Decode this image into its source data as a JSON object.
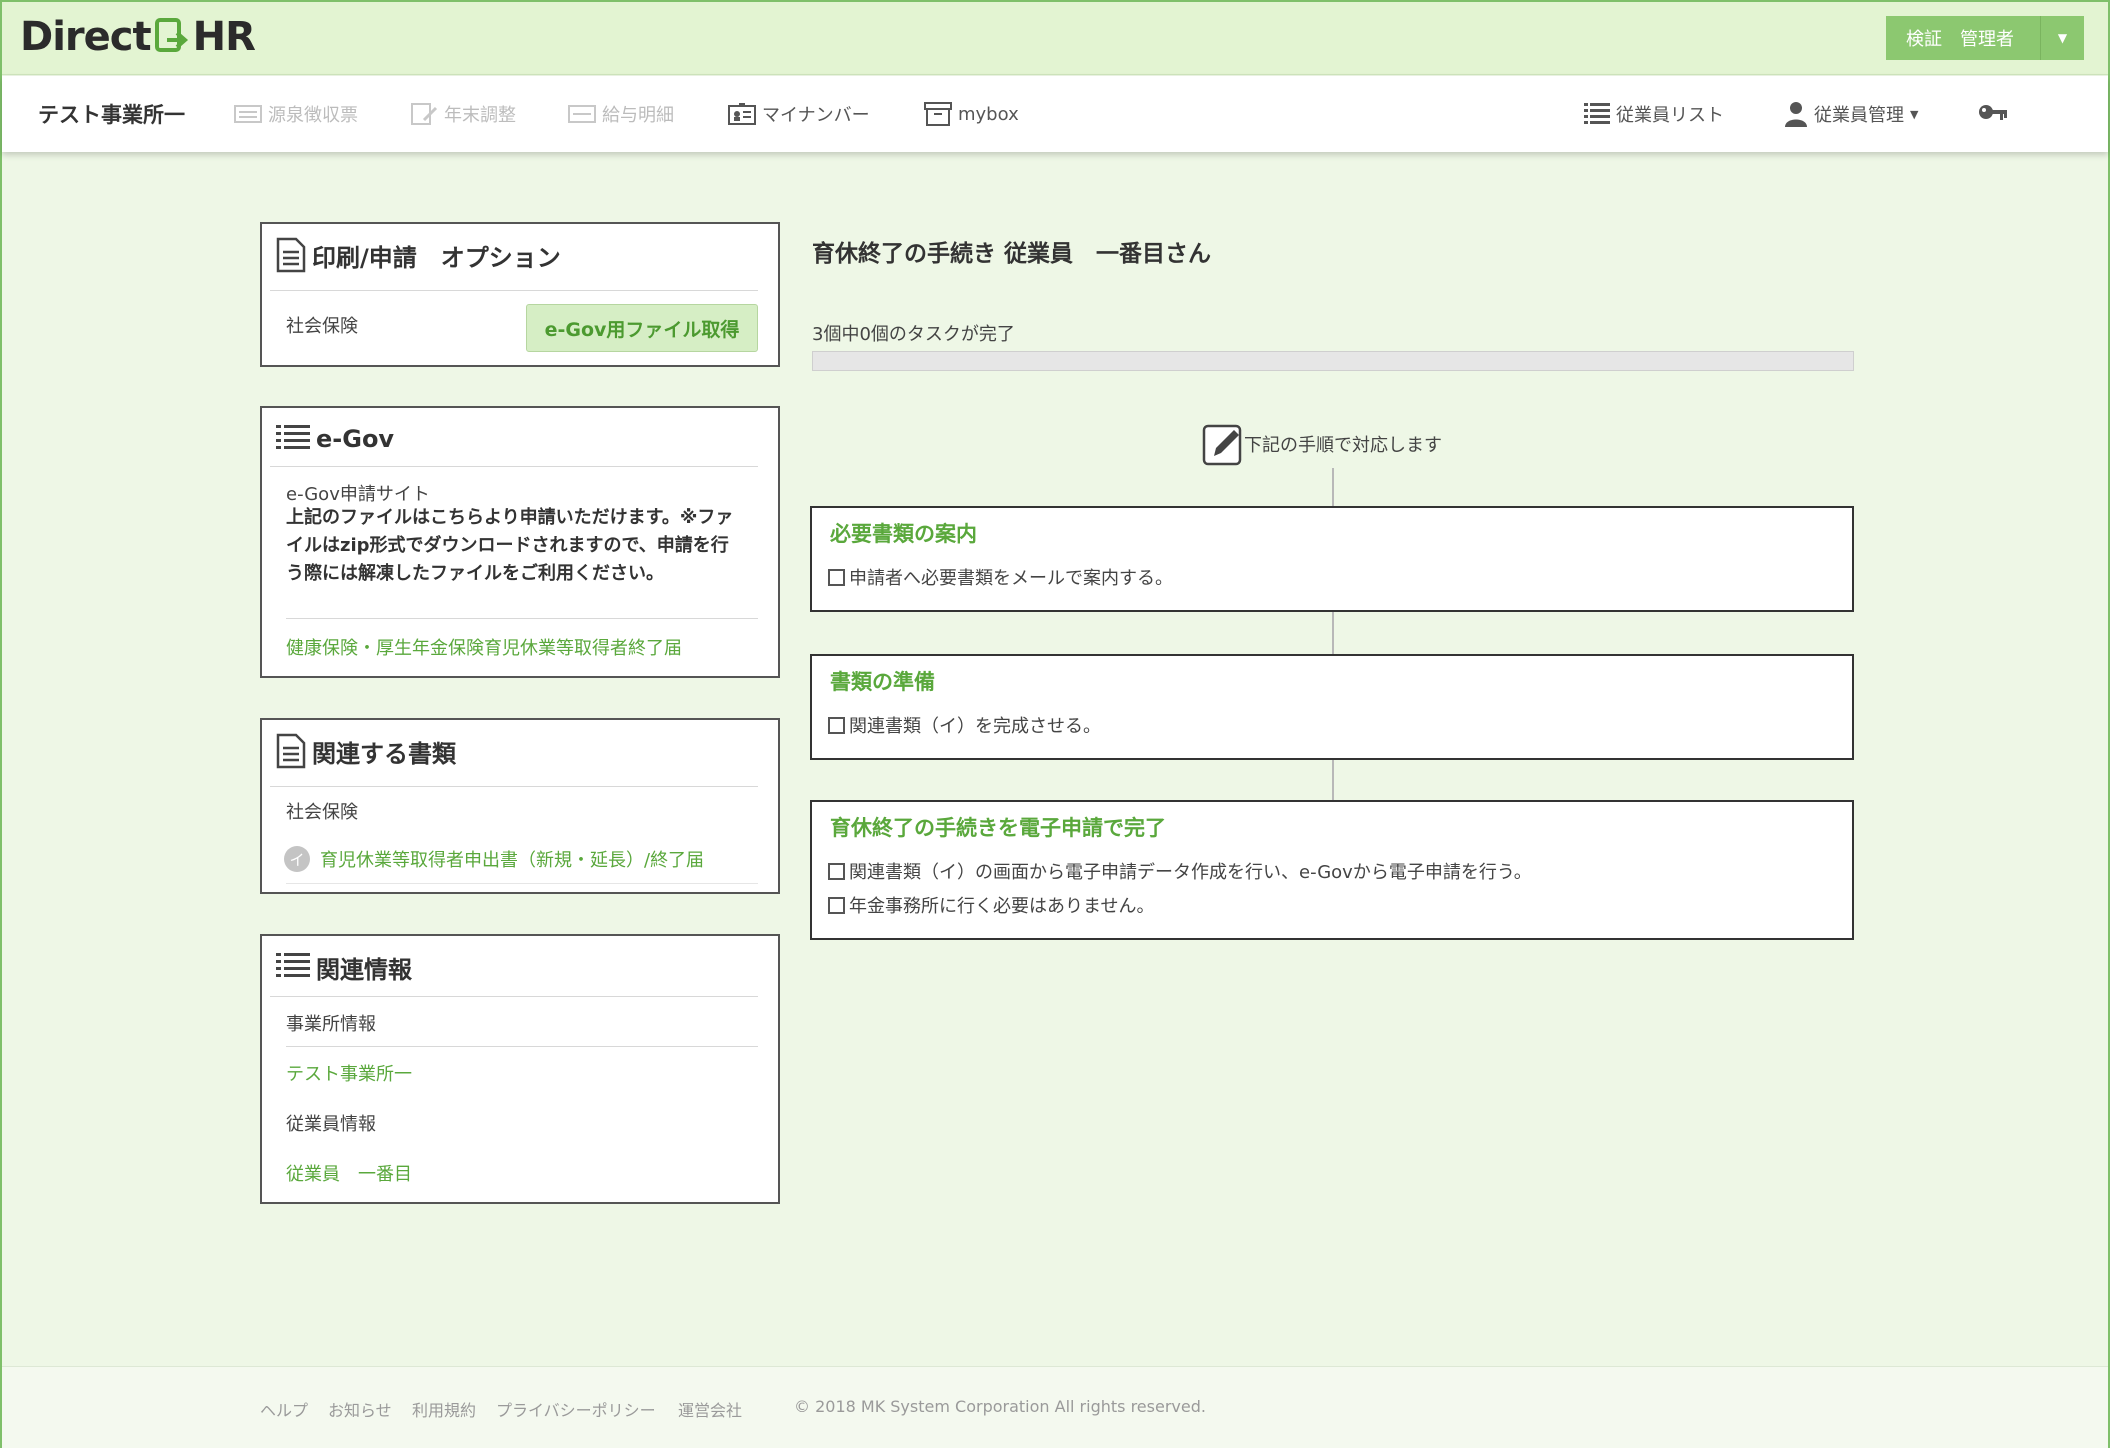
{
  "header": {
    "logo_left": "Direct",
    "logo_right": "HR",
    "account_label": "検証　管理者"
  },
  "nav": {
    "office": "テスト事業所一",
    "items": [
      {
        "label": "源泉徴収票",
        "icon": "receipt-icon",
        "disabled": true
      },
      {
        "label": "年末調整",
        "icon": "edit-document-icon",
        "disabled": true
      },
      {
        "label": "給与明細",
        "icon": "payslip-icon",
        "disabled": true
      },
      {
        "label": "マイナンバー",
        "icon": "id-card-icon",
        "disabled": false
      },
      {
        "label": "mybox",
        "icon": "box-icon",
        "disabled": false
      }
    ],
    "employee_list": "従業員リスト",
    "employee_manage": "従業員管理"
  },
  "print_panel": {
    "title": "印刷/申請　オプション",
    "row_label": "社会保険",
    "button": "e-Gov用ファイル取得"
  },
  "egov_panel": {
    "title": "e-Gov",
    "site_label": "e-Gov申請サイト",
    "note": "上記のファイルはこちらより申請いただけます。※ファイルはzip形式でダウンロードされますので、申請を行う際には解凍したファイルをご利用ください。",
    "link": "健康保険・厚生年金保険育児休業等取得者終了届"
  },
  "docs_panel": {
    "title": "関連する書類",
    "category": "社会保険",
    "badge": "イ",
    "doc_link": "育児休業等取得者申出書（新規・延長）/終了届"
  },
  "info_panel": {
    "title": "関連情報",
    "office_label": "事業所情報",
    "office_link": "テスト事業所一",
    "employee_label": "従業員情報",
    "employee_link": "従業員　一番目"
  },
  "main": {
    "title": "育休終了の手続き  従業員　一番目さん",
    "progress_text": "3個中0個のタスクが完了",
    "progress_fraction": 0,
    "flow_heading": "下記の手順で対応します",
    "tasks": [
      {
        "title": "必要書類の案内",
        "items": [
          "申請者へ必要書類をメールで案内する。"
        ]
      },
      {
        "title": "書類の準備",
        "items": [
          "関連書類（イ）を完成させる。"
        ]
      },
      {
        "title": "育休終了の手続きを電子申請で完了",
        "items": [
          "関連書類（イ）の画面から電子申請データ作成を行い、e-Govから電子申請を行う。",
          "年金事務所に行く必要はありません。"
        ]
      }
    ]
  },
  "footer": {
    "links": [
      "ヘルプ",
      "お知らせ",
      "利用規約",
      "プライバシーポリシー",
      "運営会社"
    ],
    "copyright": "© 2018 MK System Corporation All rights reserved."
  },
  "colors": {
    "accent_green": "#5aa83c",
    "header_bg": "#e3f4d2",
    "button_green": "#8cc870"
  }
}
